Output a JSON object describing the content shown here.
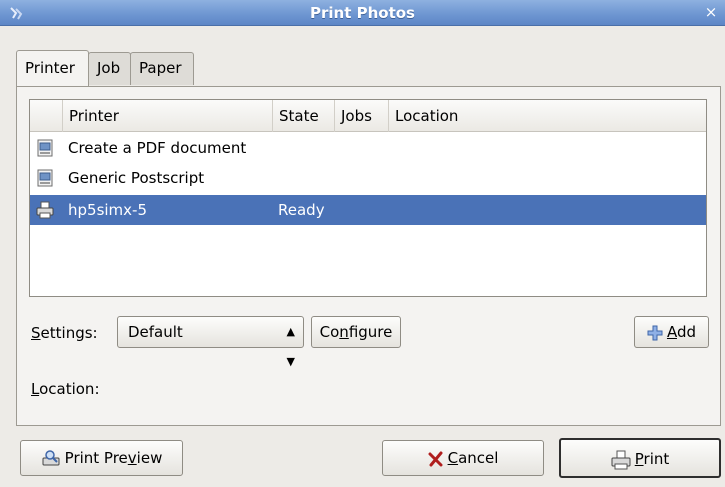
{
  "window": {
    "title": "Print Photos",
    "close_glyph": "×",
    "colors": {
      "titlebar": "#6f97d2",
      "selection": "#4a72b7",
      "background": "#edebe7"
    }
  },
  "tabs": [
    {
      "label": "Printer",
      "active": true
    },
    {
      "label": "Job",
      "active": false
    },
    {
      "label": "Paper",
      "active": false
    }
  ],
  "printer_list": {
    "columns": [
      "Printer",
      "State",
      "Jobs",
      "Location"
    ],
    "rows": [
      {
        "icon": "pdf-printer-icon",
        "name": "Create a PDF document",
        "state": "",
        "jobs": "",
        "location": "",
        "selected": false
      },
      {
        "icon": "postscript-printer-icon",
        "name": "Generic Postscript",
        "state": "",
        "jobs": "",
        "location": "",
        "selected": false
      },
      {
        "icon": "printer-icon",
        "name": "hp5simx-5",
        "state": "Ready",
        "jobs": "",
        "location": "",
        "selected": true
      }
    ]
  },
  "settings": {
    "label_pre": "",
    "label_mnemonic": "S",
    "label_post": "ettings:",
    "selected_value": "Default",
    "configure_pre": "Co",
    "configure_mnemonic": "n",
    "configure_post": "figure",
    "add_mnemonic": "A",
    "add_post": "dd"
  },
  "location": {
    "label_mnemonic": "L",
    "label_post": "ocation:"
  },
  "buttons": {
    "print_preview_pre": "Print Pre",
    "print_preview_mnemonic": "v",
    "print_preview_post": "iew",
    "cancel_mnemonic": "C",
    "cancel_post": "ancel",
    "print_mnemonic": "P",
    "print_post": "rint"
  }
}
